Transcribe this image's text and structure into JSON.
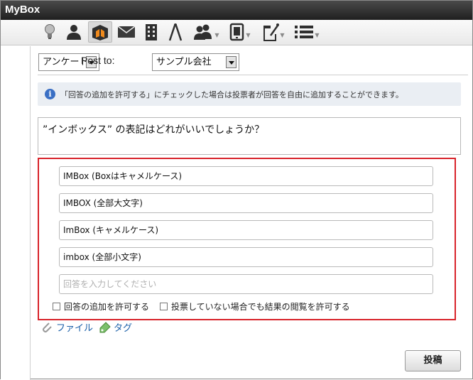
{
  "app": {
    "title": "MyBox"
  },
  "toolbar": {
    "icons": [
      "lightbulb-icon",
      "user-icon",
      "box-icon",
      "mail-icon",
      "building-icon",
      "compass-icon",
      "group-icon",
      "phone-icon",
      "edit-pin-icon",
      "list-icon"
    ]
  },
  "form": {
    "type_select": "アンケート",
    "post_to_label": "Post to:",
    "post_to_select": "サンプル会社",
    "info_text": "「回答の追加を許可する」にチェックした場合は投票者が回答を自由に追加することができます。",
    "question": "”インボックス” の表記はどれがいいでしょうか？",
    "answers": [
      "IMBox (Boxはキャメルケース)",
      "IMBOX (全部大文字)",
      "ImBox (キャメルケース)",
      "imbox (全部小文字)"
    ],
    "answer_placeholder": "回答を入力してください",
    "allow_add_label": "回答の追加を許可する",
    "allow_view_label": "投票していない場合でも結果の閲覧を許可する",
    "file_link": "ファイル",
    "tag_link": "タグ",
    "submit_label": "投稿"
  },
  "colors": {
    "highlight_border": "#d8232a",
    "link": "#1a5fa8",
    "info_icon": "#3a6fc4"
  }
}
